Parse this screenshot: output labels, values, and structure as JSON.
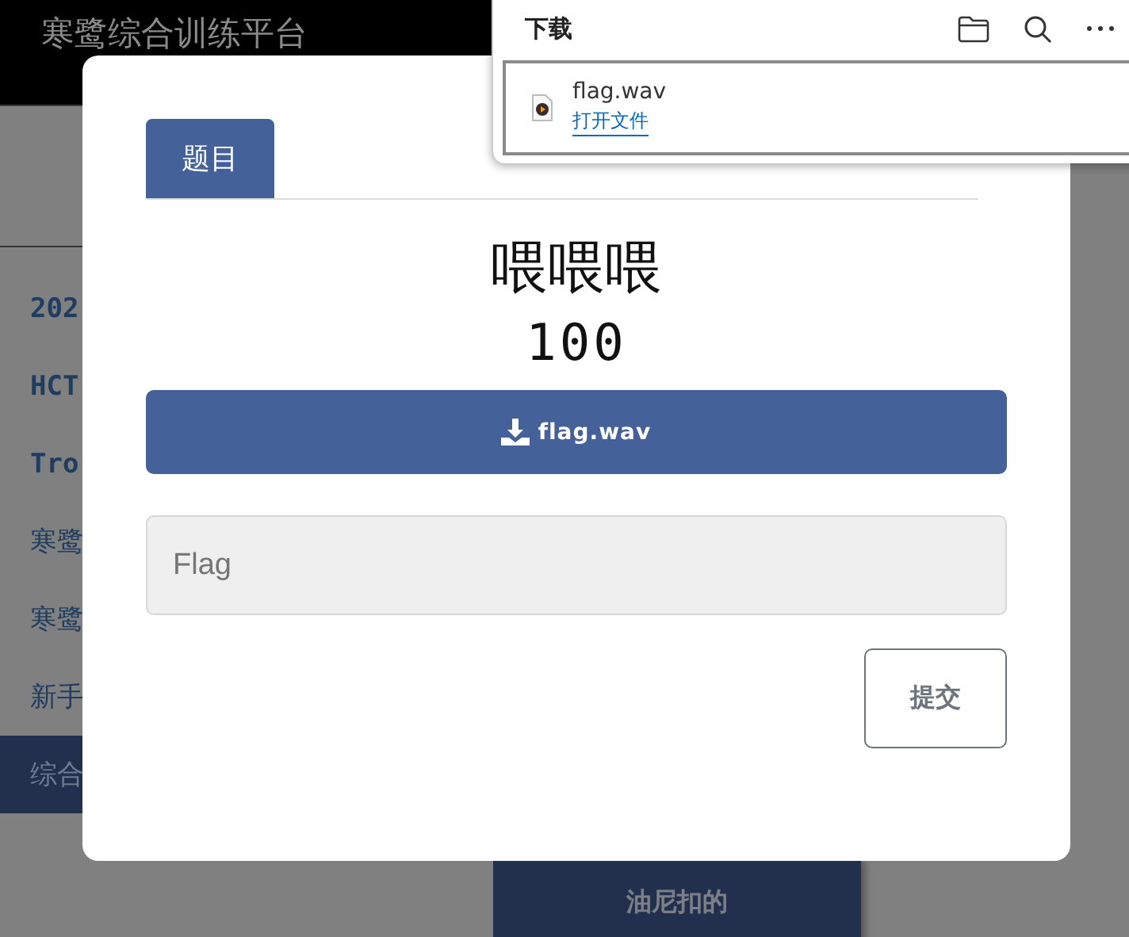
{
  "header": {
    "title": "寒鹭综合训练平台"
  },
  "sidebar": {
    "items": [
      {
        "label": "202",
        "kind": "mono",
        "selected": false
      },
      {
        "label": "HCT",
        "kind": "mono",
        "selected": false
      },
      {
        "label": "Tro",
        "kind": "mono",
        "selected": false
      },
      {
        "label": "寒鹭",
        "kind": "text",
        "selected": false
      },
      {
        "label": "寒鹭",
        "kind": "text",
        "selected": false
      },
      {
        "label": "新手",
        "kind": "text",
        "selected": false
      },
      {
        "label": "综合",
        "kind": "text",
        "selected": true
      }
    ]
  },
  "user_card": {
    "name": "油尼扣的"
  },
  "modal": {
    "tabs": [
      {
        "label": "题目",
        "selected": true
      }
    ],
    "challenge_title": "喂喂喂",
    "points": "100",
    "download_button": "flag.wav",
    "flag_field": {
      "placeholder": "Flag"
    },
    "submit_button": "提交"
  },
  "downloads_popup": {
    "title": "下载",
    "items": [
      {
        "file": "flag.wav",
        "action": "打开文件"
      }
    ]
  }
}
